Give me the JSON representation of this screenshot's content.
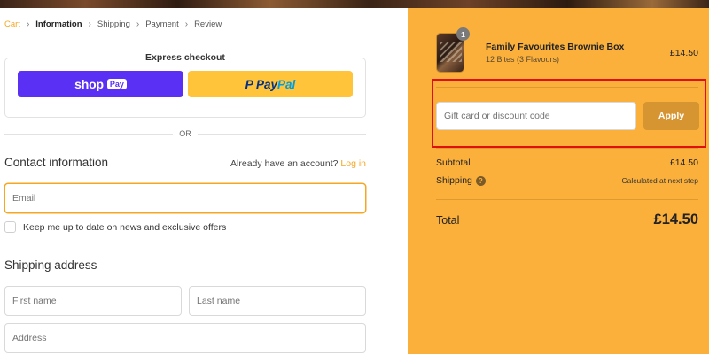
{
  "breadcrumb": {
    "cart": "Cart",
    "information": "Information",
    "shipping": "Shipping",
    "payment": "Payment",
    "review": "Review",
    "separator": "›"
  },
  "express": {
    "title": "Express checkout",
    "shop_word": "shop",
    "shop_badge": "Pay",
    "paypal_icon": "P",
    "paypal_pay": "Pay",
    "paypal_pal": "Pal"
  },
  "divider_text": "OR",
  "contact": {
    "title": "Contact information",
    "account_text": "Already have an account?",
    "login_link": "Log in",
    "email_placeholder": "Email",
    "newsletter_label": "Keep me up to date on news and exclusive offers"
  },
  "shipping": {
    "title": "Shipping address",
    "first_name_placeholder": "First name",
    "last_name_placeholder": "Last name",
    "address_placeholder": "Address"
  },
  "order": {
    "quantity": "1",
    "product_name": "Family Favourites Brownie Box",
    "product_variant": "12 Bites (3 Flavours)",
    "product_price": "£14.50",
    "discount_placeholder": "Gift card or discount code",
    "apply_label": "Apply",
    "subtotal_label": "Subtotal",
    "subtotal_value": "£14.50",
    "shipping_label": "Shipping",
    "shipping_help_icon": "?",
    "shipping_value": "Calculated at next step",
    "total_label": "Total",
    "total_value": "£14.50"
  },
  "colors": {
    "accent": "#f5a623",
    "summary_bg": "#fbb03b",
    "shop_pay": "#5a31f4",
    "paypal": "#ffc439",
    "apply_button": "#d69530",
    "highlight": "#e01010"
  }
}
